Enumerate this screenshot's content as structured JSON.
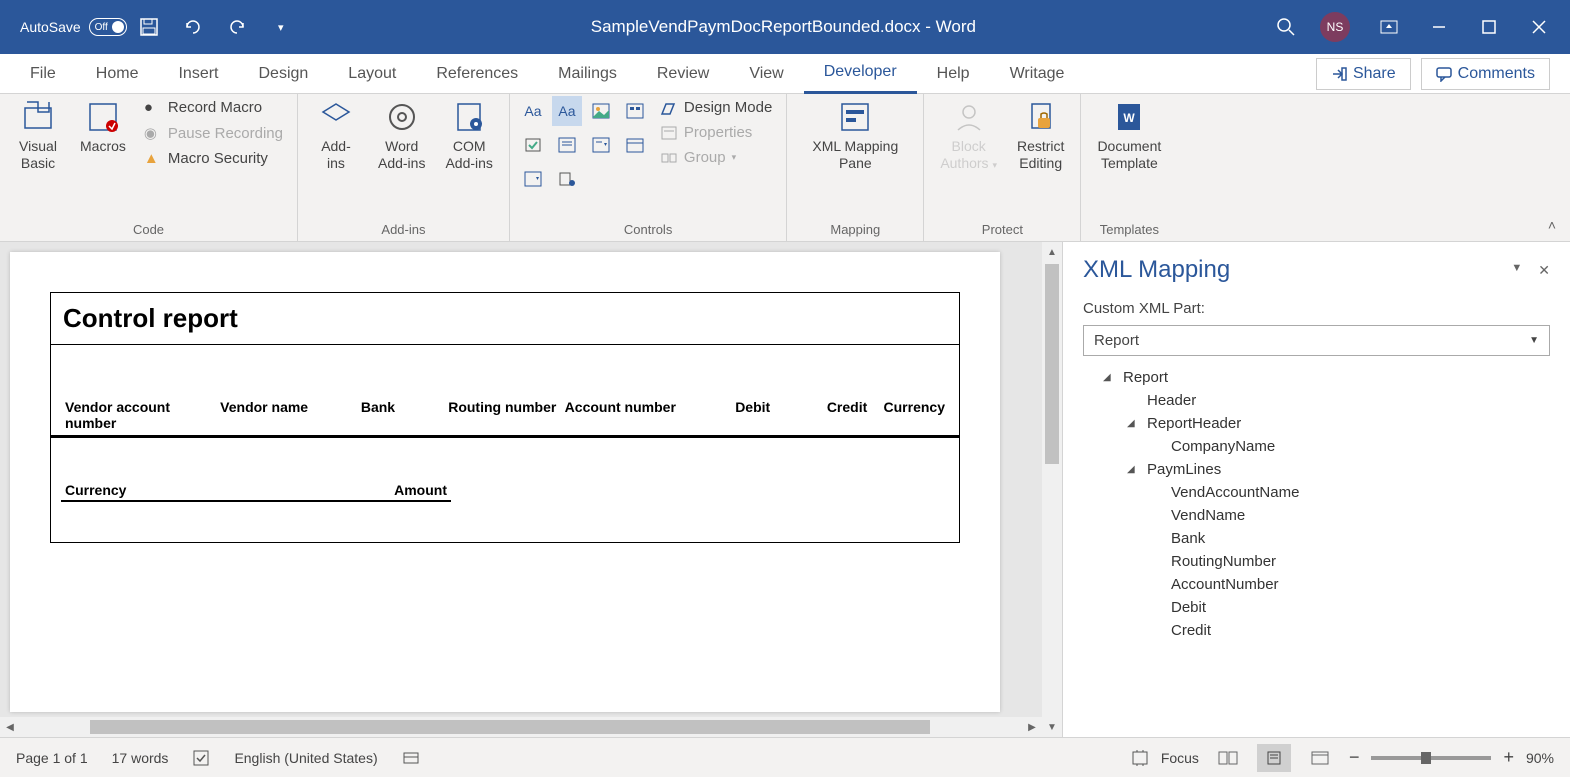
{
  "titlebar": {
    "autosave": "AutoSave",
    "autosave_state": "Off",
    "doc_name": "SampleVendPaymDocReportBounded.docx - Word",
    "user_initials": "NS"
  },
  "tabs": {
    "file": "File",
    "home": "Home",
    "insert": "Insert",
    "design": "Design",
    "layout": "Layout",
    "references": "References",
    "mailings": "Mailings",
    "review": "Review",
    "view": "View",
    "developer": "Developer",
    "help": "Help",
    "writage": "Writage"
  },
  "actions": {
    "share": "Share",
    "comments": "Comments"
  },
  "ribbon": {
    "code": {
      "visual_basic": "Visual\nBasic",
      "macros": "Macros",
      "record": "Record Macro",
      "pause": "Pause Recording",
      "security": "Macro Security",
      "label": "Code"
    },
    "addins": {
      "addins": "Add-\nins",
      "word_addins": "Word\nAdd-ins",
      "com_addins": "COM\nAdd-ins",
      "label": "Add-ins"
    },
    "controls": {
      "design_mode": "Design Mode",
      "properties": "Properties",
      "group": "Group",
      "label": "Controls"
    },
    "mapping": {
      "xml_pane": "XML Mapping\nPane",
      "label": "Mapping"
    },
    "protect": {
      "block_authors": "Block\nAuthors",
      "restrict": "Restrict\nEditing",
      "label": "Protect"
    },
    "templates": {
      "doc_template": "Document\nTemplate",
      "label": "Templates"
    }
  },
  "document": {
    "title": "Control report",
    "headers": {
      "vendor_account": "Vendor account number",
      "vendor_name": "Vendor name",
      "bank": "Bank",
      "routing": "Routing number",
      "account_number": "Account number",
      "debit": "Debit",
      "credit": "Credit",
      "currency": "Currency",
      "currency2": "Currency",
      "amount": "Amount"
    }
  },
  "xml_panel": {
    "title": "XML Mapping",
    "label": "Custom XML Part:",
    "selected": "Report",
    "tree": {
      "report": "Report",
      "header": "Header",
      "report_header": "ReportHeader",
      "company_name": "CompanyName",
      "paym_lines": "PaymLines",
      "vend_account_name": "VendAccountName",
      "vend_name": "VendName",
      "bank": "Bank",
      "routing_number": "RoutingNumber",
      "account_number": "AccountNumber",
      "debit": "Debit",
      "credit": "Credit"
    }
  },
  "statusbar": {
    "page": "Page 1 of 1",
    "words": "17 words",
    "lang": "English (United States)",
    "focus": "Focus",
    "zoom": "90%"
  }
}
